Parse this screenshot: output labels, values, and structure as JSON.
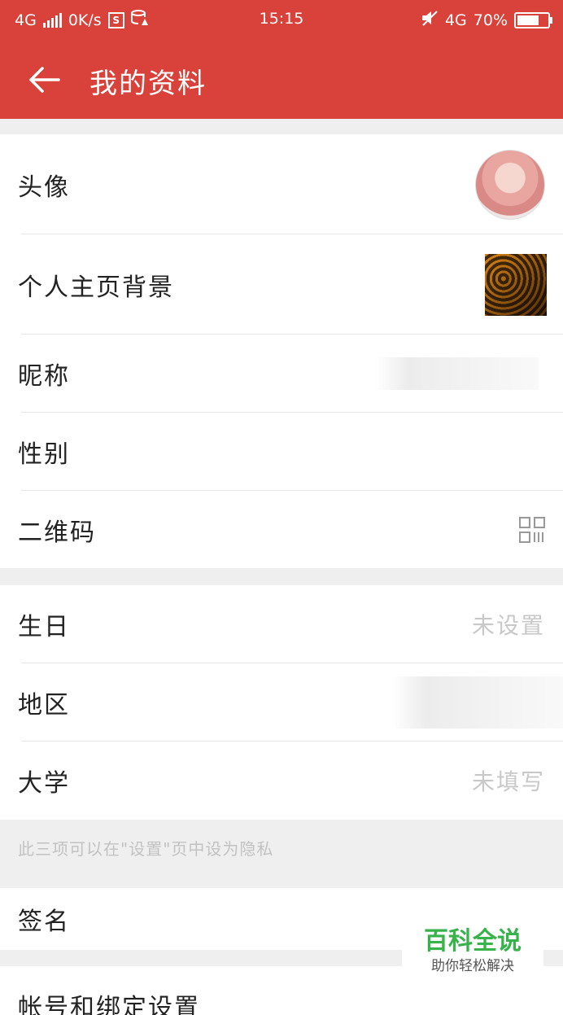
{
  "status_bar": {
    "network": "4G",
    "speed": "0K/s",
    "time": "15:15",
    "network_right": "4G",
    "battery": "70%",
    "icons": [
      "signal-icon",
      "s-app-icon",
      "data-saver-icon",
      "mute-icon",
      "battery-icon"
    ]
  },
  "app_bar": {
    "title": "我的资料",
    "back_icon": "back-arrow-icon",
    "color": "#d8423a"
  },
  "profile": {
    "avatar_label": "头像",
    "background_label": "个人主页背景",
    "nickname_label": "昵称",
    "gender_label": "性别",
    "qrcode_label": "二维码",
    "qrcode_icon": "qr-code-icon"
  },
  "details": {
    "birthday_label": "生日",
    "birthday_value": "未设置",
    "region_label": "地区",
    "university_label": "大学",
    "university_value": "未填写"
  },
  "privacy_note": "此三项可以在\"设置\"页中设为隐私",
  "signature": {
    "label": "签名"
  },
  "account": {
    "label": "帐号和绑定设置"
  },
  "watermark": {
    "title": "百科全说",
    "subtitle": "助你轻松解决"
  }
}
